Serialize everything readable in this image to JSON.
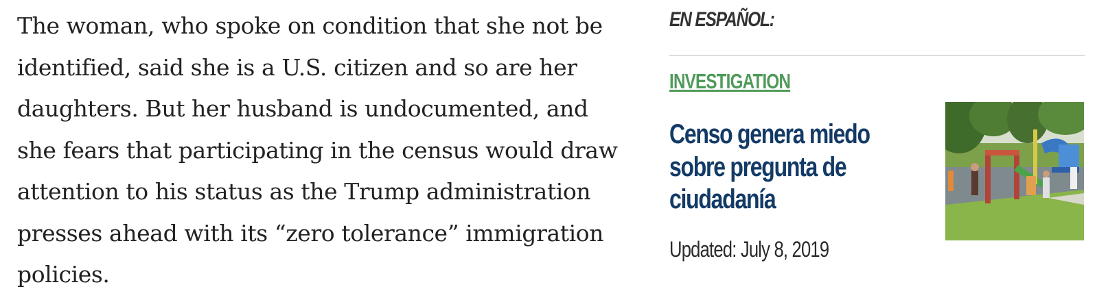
{
  "article": {
    "paragraph_lines": [
      "The woman, who spoke on condition that she not be",
      "identified, said she is a U.S. citizen and so are her",
      "daughters. But her husband is undocumented, and",
      "she fears that participating in the census would draw",
      "attention to his status as the Trump administration",
      "presses ahead with its “zero tolerance” immigration",
      "policies."
    ]
  },
  "sidebar": {
    "section_title": "EN ESPAÑOL:",
    "story": {
      "category": "INVESTIGATION",
      "headline_lines": [
        "Censo genera miedo",
        "sobre pregunta de",
        "ciudadanía"
      ],
      "updated": "Updated: July 8, 2019",
      "thumbnail_icon": "playground-photo"
    }
  },
  "colors": {
    "body_text": "#222222",
    "category_green": "#4f9a5a",
    "headline_navy": "#133a66",
    "divider": "#dcdcdc"
  }
}
